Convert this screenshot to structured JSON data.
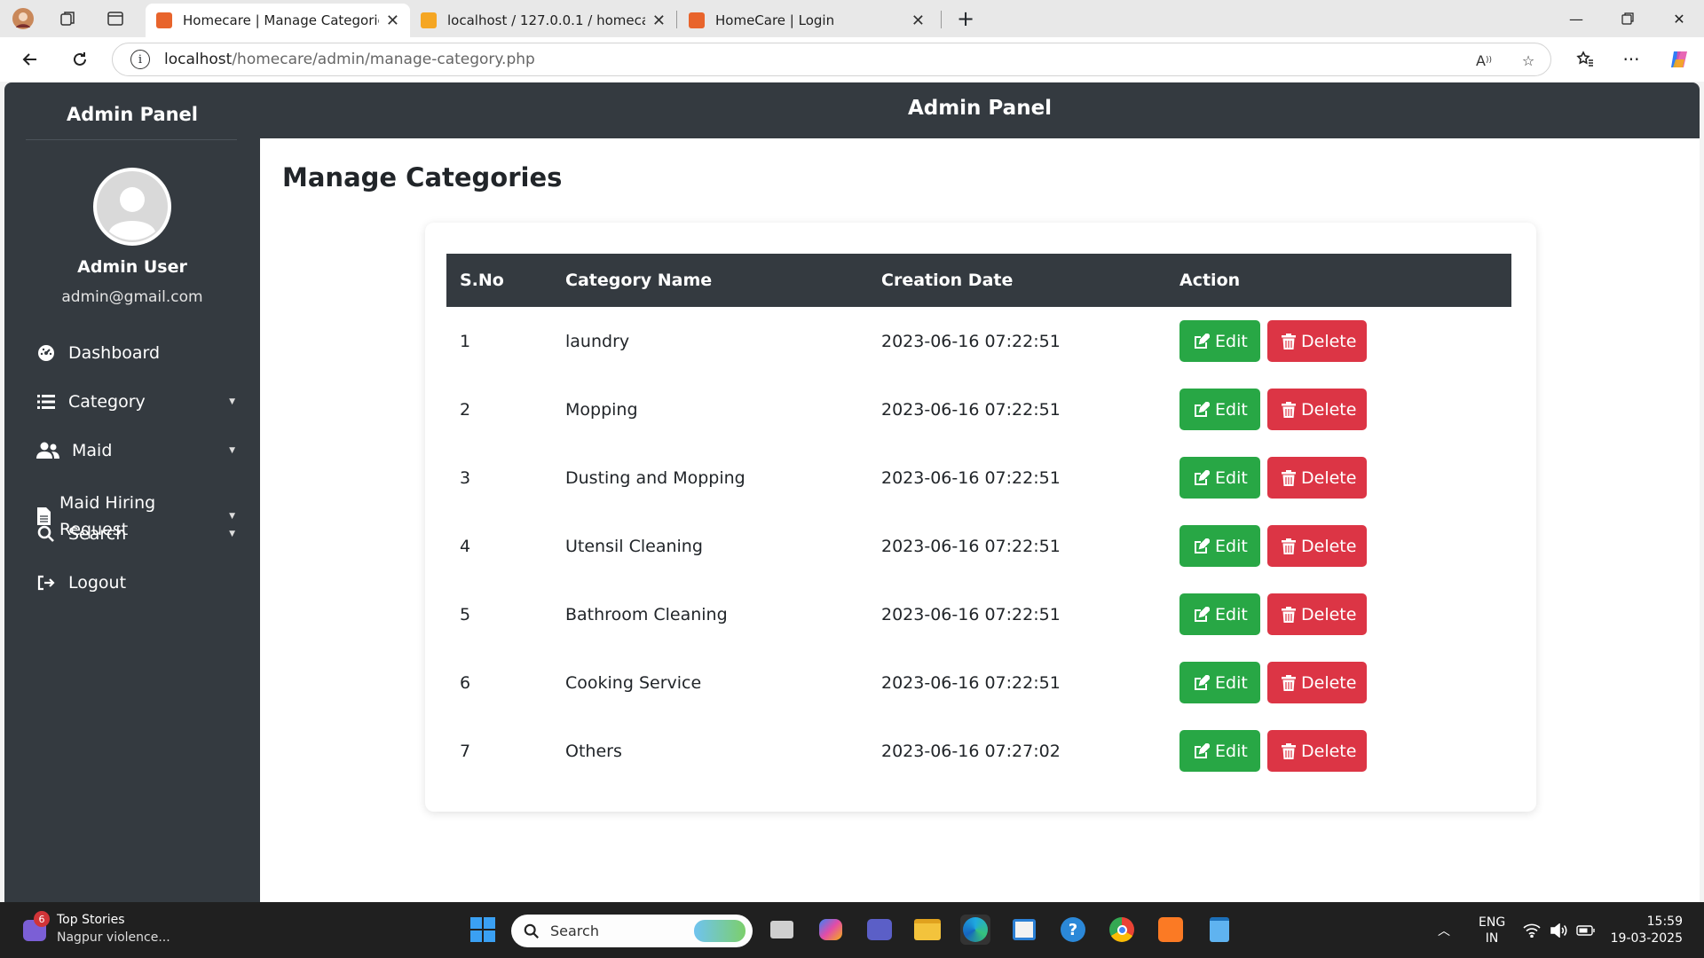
{
  "browser": {
    "tabs": [
      {
        "title": "Homecare | Manage Categories",
        "active": true,
        "favicon_color": "#e8642c"
      },
      {
        "title": "localhost / 127.0.0.1 / homecare_db",
        "active": false,
        "favicon_color": "#f5a623"
      },
      {
        "title": "HomeCare | Login",
        "active": false,
        "favicon_color": "#e8642c"
      }
    ],
    "address_bar": {
      "host": "localhost",
      "path": "/homecare/admin/manage-category.php"
    }
  },
  "sidebar": {
    "title": "Admin Panel",
    "user": {
      "name": "Admin User",
      "email": "admin@gmail.com"
    },
    "menu": [
      {
        "label": "Dashboard",
        "icon": "dashboard-icon",
        "has_caret": false
      },
      {
        "label": "Category",
        "icon": "list-icon",
        "has_caret": true
      },
      {
        "label": "Maid",
        "icon": "users-icon",
        "has_caret": true
      },
      {
        "label": "Maid Hiring Request",
        "icon": "file-icon",
        "has_caret": true
      },
      {
        "label": "Search",
        "icon": "search-icon",
        "has_caret": true
      },
      {
        "label": "Logout",
        "icon": "logout-icon",
        "has_caret": false
      }
    ]
  },
  "header": {
    "title": "Admin Panel"
  },
  "main": {
    "page_title": "Manage Categories",
    "table": {
      "columns": [
        "S.No",
        "Category Name",
        "Creation Date",
        "Action"
      ],
      "rows": [
        {
          "sno": "1",
          "name": "laundry",
          "date": "2023-06-16 07:22:51"
        },
        {
          "sno": "2",
          "name": "Mopping",
          "date": "2023-06-16 07:22:51"
        },
        {
          "sno": "3",
          "name": "Dusting and Mopping",
          "date": "2023-06-16 07:22:51"
        },
        {
          "sno": "4",
          "name": "Utensil Cleaning",
          "date": "2023-06-16 07:22:51"
        },
        {
          "sno": "5",
          "name": "Bathroom Cleaning",
          "date": "2023-06-16 07:22:51"
        },
        {
          "sno": "6",
          "name": "Cooking Service",
          "date": "2023-06-16 07:22:51"
        },
        {
          "sno": "7",
          "name": "Others",
          "date": "2023-06-16 07:27:02"
        }
      ],
      "edit_label": "Edit",
      "delete_label": "Delete"
    }
  },
  "colors": {
    "dark": "#343a40",
    "edit": "#28a745",
    "delete": "#dc3545"
  },
  "taskbar": {
    "news": {
      "badge": "6",
      "title": "Top Stories",
      "subtitle": "Nagpur violence..."
    },
    "search_placeholder": "Search",
    "lang": {
      "line1": "ENG",
      "line2": "IN"
    },
    "time": "15:59",
    "date": "19-03-2025"
  }
}
